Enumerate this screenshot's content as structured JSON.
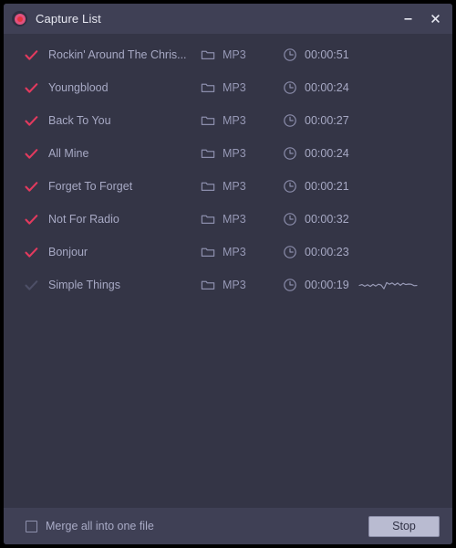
{
  "window": {
    "title": "Capture List",
    "record_icon": "record-icon",
    "minimize_label": "–",
    "close_label": "×"
  },
  "list": {
    "rows": [
      {
        "checked": true,
        "name": "Rockin' Around The Chris...",
        "format": "MP3",
        "duration": "00:00:51",
        "waveform": false
      },
      {
        "checked": true,
        "name": "Youngblood",
        "format": "MP3",
        "duration": "00:00:24",
        "waveform": false
      },
      {
        "checked": true,
        "name": "Back To You",
        "format": "MP3",
        "duration": "00:00:27",
        "waveform": false
      },
      {
        "checked": true,
        "name": "All Mine",
        "format": "MP3",
        "duration": "00:00:24",
        "waveform": false
      },
      {
        "checked": true,
        "name": "Forget To Forget",
        "format": "MP3",
        "duration": "00:00:21",
        "waveform": false
      },
      {
        "checked": true,
        "name": "Not For Radio",
        "format": "MP3",
        "duration": "00:00:32",
        "waveform": false
      },
      {
        "checked": true,
        "name": "Bonjour",
        "format": "MP3",
        "duration": "00:00:23",
        "waveform": false
      },
      {
        "checked": false,
        "name": "Simple Things",
        "format": "MP3",
        "duration": "00:00:19",
        "waveform": true
      }
    ]
  },
  "footer": {
    "merge_label": "Merge all into one file",
    "merge_checked": false,
    "stop_label": "Stop"
  },
  "colors": {
    "window_bg": "#343546",
    "bar_bg": "#3f4055",
    "accent_check": "#e23a5e",
    "muted_check": "#4d4f66",
    "text_primary": "#e8e9f2",
    "text_secondary": "#a7a9c4",
    "button_bg": "#b9bbd1"
  }
}
